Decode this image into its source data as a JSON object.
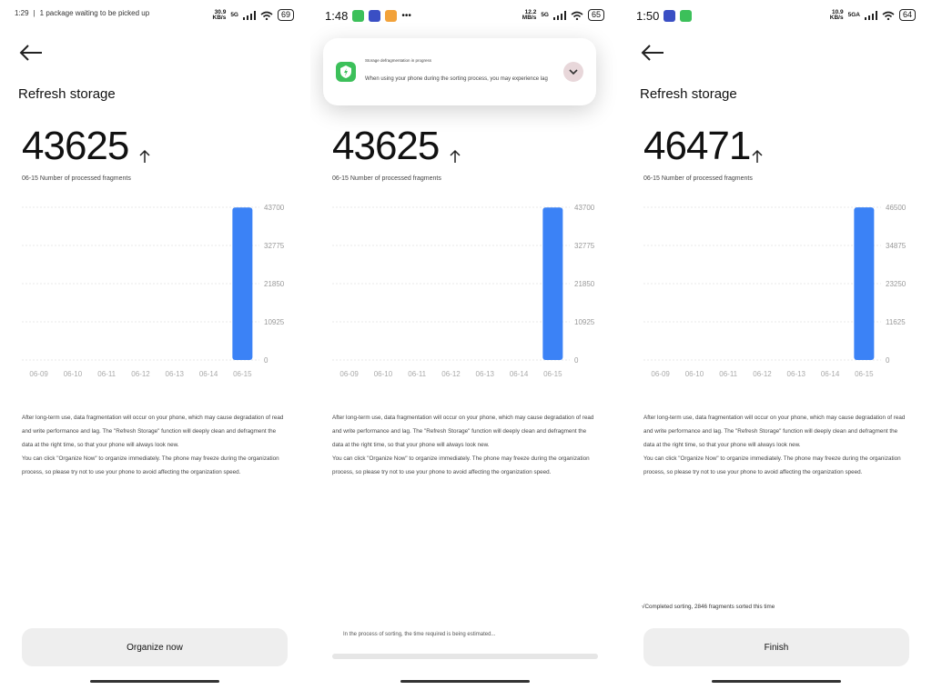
{
  "panels": [
    {
      "status": {
        "time": "1:29",
        "notice": "1 package waiting to be picked up",
        "speed": "30.9\nKB/s",
        "net": "5G",
        "battery": "69"
      },
      "title": "Refresh storage",
      "number": "43625",
      "subtitle": "06-15 Number of processed fragments",
      "chart_data": {
        "type": "bar",
        "categories": [
          "06-09",
          "06-10",
          "06-11",
          "06-12",
          "06-13",
          "06-14",
          "06-15"
        ],
        "values": [
          0,
          0,
          0,
          0,
          0,
          0,
          43625
        ],
        "ylim": [
          0,
          43700
        ],
        "yticks": [
          "43700",
          "32775",
          "21850",
          "10925",
          "0"
        ],
        "color": "#3b82f6"
      },
      "desc": [
        "After long-term use, data fragmentation will occur on your phone, which may cause degradation of read and write performance and lag. The \"Refresh Storage\" function will deeply clean and defragment the data at the right time, so that your phone will always look new.",
        "You can click \"Organize Now\" to organize immediately. The phone may freeze during the organization process, so please try not to use your phone to avoid affecting the organization speed."
      ],
      "button": "Organize now"
    },
    {
      "status": {
        "time": "1:48",
        "speed": "12.2\nMB/s",
        "net": "5G",
        "battery": "65"
      },
      "notification": {
        "title": "Storage defragmentation in progress",
        "body": "When using your phone during the sorting process, you may experience lag"
      },
      "number": "43625",
      "subtitle": "06-15 Number of processed fragments",
      "chart_data": {
        "type": "bar",
        "categories": [
          "06-09",
          "06-10",
          "06-11",
          "06-12",
          "06-13",
          "06-14",
          "06-15"
        ],
        "values": [
          0,
          0,
          0,
          0,
          0,
          0,
          43625
        ],
        "ylim": [
          0,
          43700
        ],
        "yticks": [
          "43700",
          "32775",
          "21850",
          "10925",
          "0"
        ],
        "color": "#3b82f6"
      },
      "desc": [
        "After long-term use, data fragmentation will occur on your phone, which may cause degradation of read and write performance and lag. The \"Refresh Storage\" function will deeply clean and defragment the data at the right time, so that your phone will always look new.",
        "You can click \"Organize Now\" to organize immediately. The phone may freeze during the organization process, so please try not to use your phone to avoid affecting the organization speed."
      ],
      "progress_text": "In the process of sorting, the time required is being estimated..."
    },
    {
      "status": {
        "time": "1:50",
        "speed": "10.9\nKB/s",
        "net": "5GA",
        "battery": "64"
      },
      "title": "Refresh storage",
      "number": "46471",
      "subtitle": "06-15 Number of processed fragments",
      "chart_data": {
        "type": "bar",
        "categories": [
          "06-09",
          "06-10",
          "06-11",
          "06-12",
          "06-13",
          "06-14",
          "06-15"
        ],
        "values": [
          0,
          0,
          0,
          0,
          0,
          0,
          46471
        ],
        "ylim": [
          0,
          46500
        ],
        "yticks": [
          "46500",
          "34875",
          "23250",
          "11625",
          "0"
        ],
        "color": "#3b82f6"
      },
      "desc": [
        "After long-term use, data fragmentation will occur on your phone, which may cause degradation of read and write performance and lag. The \"Refresh Storage\" function will deeply clean and defragment the data at the right time, so that your phone will always look new.",
        "You can click \"Organize Now\" to organize immediately. The phone may freeze during the organization process, so please try not to use your phone to avoid affecting the organization speed."
      ],
      "completed": "√Completed sorting, 2846 fragments sorted this time",
      "button": "Finish"
    }
  ]
}
